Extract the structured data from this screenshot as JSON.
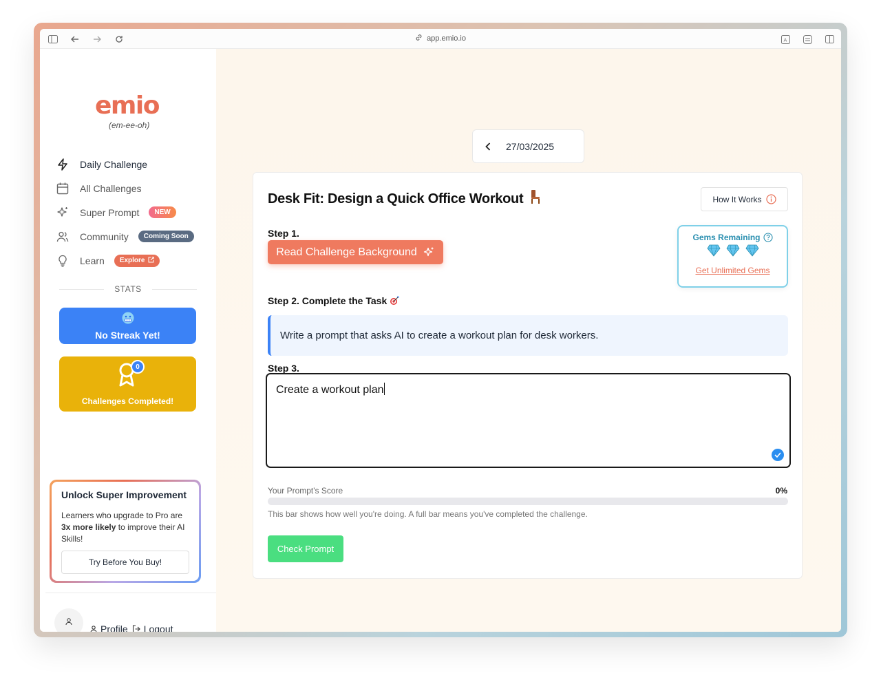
{
  "browser": {
    "url": "app.emio.io"
  },
  "sidebar": {
    "logo": "emio",
    "logo_sub": "(em-ee-oh)",
    "nav": [
      {
        "label": "Daily Challenge",
        "icon": "bolt-icon",
        "badge": ""
      },
      {
        "label": "All Challenges",
        "icon": "calendar-icon",
        "badge": ""
      },
      {
        "label": "Super Prompt",
        "icon": "sparkles-icon",
        "badge": "NEW"
      },
      {
        "label": "Community",
        "icon": "users-icon",
        "badge": "Coming Soon"
      },
      {
        "label": "Learn",
        "icon": "lightbulb-icon",
        "badge": "Explore"
      }
    ],
    "stats_label": "STATS",
    "streak": {
      "label": "No Streak Yet!",
      "icon": "frozen-face-icon"
    },
    "challenges": {
      "label": "Challenges Completed!",
      "count": "0",
      "icon": "award-ribbon-icon"
    },
    "upsell": {
      "title": "Unlock Super Improvement",
      "text_before": "Learners who upgrade to Pro are",
      "text_bold": "3x more likely",
      "text_after": "to improve their AI Skills!",
      "button": "Try Before You Buy!"
    },
    "profile_label": "Profile",
    "logout_label": "Logout"
  },
  "main": {
    "date": "27/03/2025",
    "challenge": {
      "title": "Desk Fit: Design a Quick Office Workout",
      "how_it_works": "How It Works",
      "step1_label": "Step 1.",
      "read_button": "Read Challenge Background",
      "gems": {
        "title": "Gems Remaining",
        "count": 3,
        "link": "Get Unlimited Gems"
      },
      "step2_label": "Step 2. Complete the Task",
      "task": "Write a prompt that asks AI to create a workout plan for desk workers.",
      "step3_label": "Step 3.",
      "prompt_value": "Create a workout plan",
      "score_label": "Your Prompt's Score",
      "score_pct": "0%",
      "score_value": 0,
      "score_help": "This bar shows how well you're doing. A full bar means you've completed the challenge.",
      "check_button": "Check Prompt"
    }
  },
  "colors": {
    "accent": "#e86f55",
    "blue": "#3b82f6",
    "yellow": "#e9b20a",
    "green": "#4ade80"
  }
}
